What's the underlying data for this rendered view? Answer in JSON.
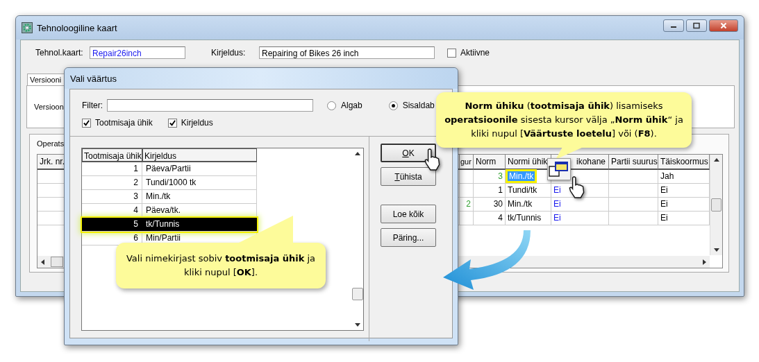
{
  "main_window": {
    "title": "Tehnoloogiline kaart",
    "card_label": "Tehnol.kaart:",
    "card_value": "Repair26inch",
    "description_label": "Kirjeldus:",
    "description_value": "Repairing of Bikes 26 inch",
    "active": {
      "label": "Aktiivne",
      "checked": false
    },
    "tab": "Versiooni",
    "version_label": "Versioon",
    "operations_label": "Operats",
    "grid": {
      "left_column": "Jrk. nr.",
      "columns": [
        "gur",
        "Norm",
        "Normi ühik",
        "ikohane",
        "Partii suurus",
        "Täiskoormus"
      ],
      "rows": [
        {
          "cells": [
            null,
            {
              "text": "3",
              "color": "#2e9e2e"
            },
            {
              "text": "Min./tk",
              "selected": true
            },
            null,
            null,
            "Jah"
          ]
        },
        {
          "cells": [
            null,
            "1",
            "Tundi/tk",
            {
              "text": "Ei",
              "color": "#1a1aee"
            },
            null,
            "Ei"
          ]
        },
        {
          "cells": [
            {
              "text": "2",
              "color": "#2e9e2e"
            },
            "30",
            "Min./tk",
            {
              "text": "Ei",
              "color": "#1a1aee"
            },
            null,
            "Ei"
          ]
        },
        {
          "cells": [
            null,
            "4",
            "tk/Tunnis",
            {
              "text": "Ei",
              "color": "#1a1aee"
            },
            null,
            "Ei"
          ]
        }
      ]
    }
  },
  "dialog": {
    "title": "Vali väärtus",
    "filter_label": "Filter:",
    "match_modes": [
      {
        "label": "Algab",
        "selected": false
      },
      {
        "label": "Sisaldab",
        "selected": true
      }
    ],
    "columns_shown": [
      {
        "label": "Tootmisaja ühik",
        "checked": true
      },
      {
        "label": "Kirjeldus",
        "checked": true
      }
    ],
    "list": {
      "columns": [
        "Tootmisaja ühik",
        "Kirjeldus"
      ],
      "rows": [
        {
          "unit": "1",
          "description": "Päeva/Partii",
          "selected": false
        },
        {
          "unit": "2",
          "description": "Tundi/1000 tk",
          "selected": false
        },
        {
          "unit": "3",
          "description": "Min./tk",
          "selected": false
        },
        {
          "unit": "4",
          "description": "Päeva/tk.",
          "selected": false
        },
        {
          "unit": "5",
          "description": "tk/Tunnis",
          "selected": true
        },
        {
          "unit": "6",
          "description": "Min/Partii",
          "selected": false
        }
      ]
    },
    "buttons": [
      {
        "label": "OK",
        "accelerator": true
      },
      {
        "label": "Tühista",
        "accelerator": true
      },
      {
        "label": "Loe kõik",
        "accelerator": false
      },
      {
        "label": "Päring...",
        "accelerator": false
      }
    ]
  },
  "callouts": [
    {
      "text": "**Norm ühiku** (**tootmisaja ühik**) lisamiseks **operatsioonile** sisesta kursor välja „**Norm ühik**“ ja kliki nupul [**Väärtuste loetelu**] või (**F8**)."
    },
    {
      "text": "Vali nimekirjast sobiv **tootmisaja ühik** ja kliki nupul [**OK**]."
    }
  ]
}
